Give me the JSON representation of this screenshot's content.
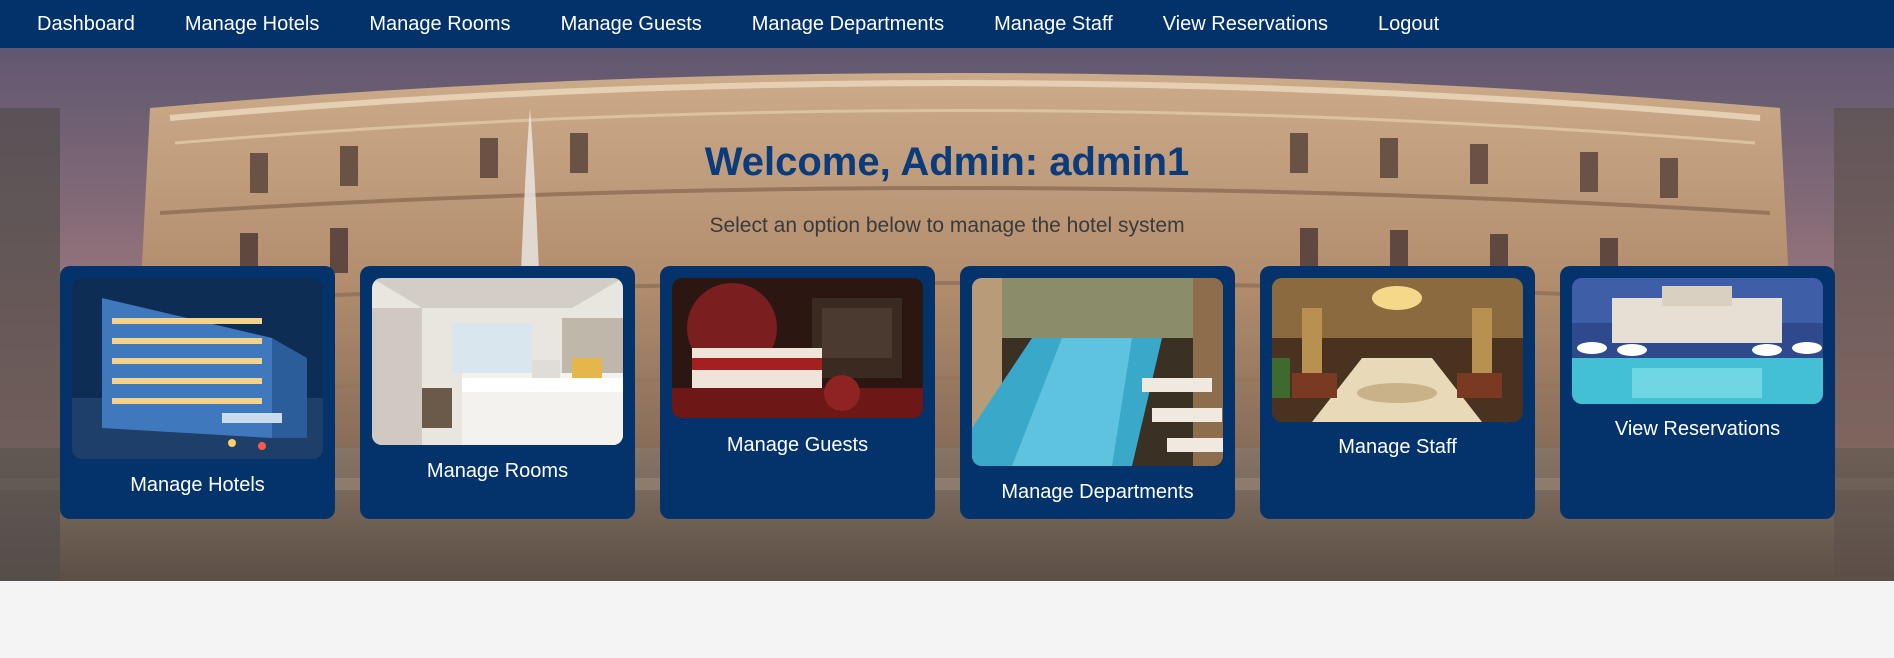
{
  "nav": {
    "items": [
      {
        "label": "Dashboard"
      },
      {
        "label": "Manage Hotels"
      },
      {
        "label": "Manage Rooms"
      },
      {
        "label": "Manage Guests"
      },
      {
        "label": "Manage Departments"
      },
      {
        "label": "Manage Staff"
      },
      {
        "label": "View Reservations"
      },
      {
        "label": "Logout"
      }
    ]
  },
  "hero": {
    "welcome": "Welcome, Admin: admin1",
    "subtitle": "Select an option below to manage the hotel system"
  },
  "cards": [
    {
      "label": "Manage Hotels"
    },
    {
      "label": "Manage Rooms"
    },
    {
      "label": "Manage Guests"
    },
    {
      "label": "Manage Departments"
    },
    {
      "label": "Manage Staff"
    },
    {
      "label": "View Reservations"
    }
  ],
  "colors": {
    "nav_bg": "#03326a",
    "card_bg": "#04336b",
    "welcome_text": "#0a3b7a",
    "page_bg": "#f4f4f4"
  }
}
